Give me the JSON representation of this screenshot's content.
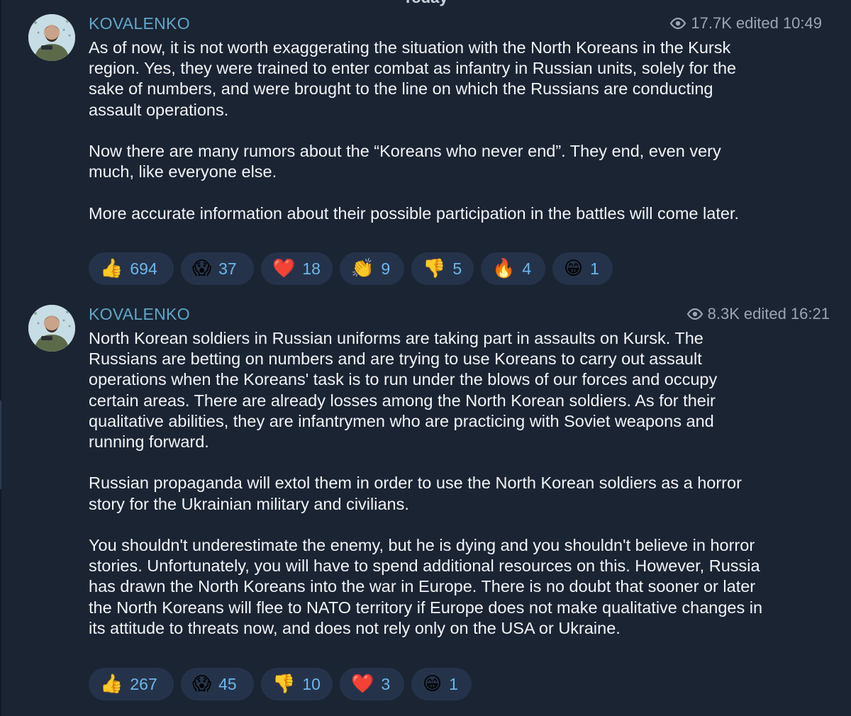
{
  "date_chip": "Today",
  "messages": [
    {
      "author": "KOVALENKO",
      "views": "17.7K",
      "edited_time": "edited 10:49",
      "paragraphs": [
        "As of now, it is not worth exaggerating the situation with the North Koreans in the Kursk region. Yes, they were trained to enter combat as infantry in Russian units, solely for the sake of numbers, and were brought to the line on which the Russians are conducting assault operations.",
        "Now there are many rumors about the “Koreans who never end”. They end, even very much, like everyone else.",
        "More accurate information about their possible participation in the battles will come later."
      ],
      "reactions": [
        {
          "emoji": "👍",
          "icon": "thumbs-up-icon",
          "count": "694"
        },
        {
          "emoji": "😱",
          "icon": "screaming-face-icon",
          "count": "37"
        },
        {
          "emoji": "❤️",
          "icon": "heart-icon",
          "count": "18"
        },
        {
          "emoji": "👏",
          "icon": "clapping-hands-icon",
          "count": "9"
        },
        {
          "emoji": "👎",
          "icon": "thumbs-down-icon",
          "count": "5"
        },
        {
          "emoji": "🔥",
          "icon": "fire-icon",
          "count": "4"
        },
        {
          "emoji": "😁",
          "icon": "grinning-face-icon",
          "count": "1"
        }
      ]
    },
    {
      "author": "KOVALENKO",
      "views": "8.3K",
      "edited_time": "edited 16:21",
      "paragraphs": [
        "North Korean soldiers in Russian uniforms are taking part in assaults on Kursk. The Russians are betting on numbers and are trying to use Koreans to carry out assault operations when the Koreans' task is to run under the blows of our forces and occupy certain areas. There are already losses among the North Korean soldiers. As for their qualitative abilities, they are infantrymen who are practicing with Soviet weapons and running forward.",
        "Russian propaganda will extol them in order to use the North Korean soldiers as a horror story for the Ukrainian military and civilians.",
        "You shouldn't underestimate the enemy, but he is dying and you shouldn't believe in horror stories. Unfortunately, you will have to spend additional resources on this. However, Russia has drawn the North Koreans into the war in Europe. There is no doubt that sooner or later the North Koreans will flee to NATO territory if Europe does not make qualitative changes in its attitude to threats now, and does not rely only on the USA or Ukraine."
      ],
      "reactions": [
        {
          "emoji": "👍",
          "icon": "thumbs-up-icon",
          "count": "267"
        },
        {
          "emoji": "😱",
          "icon": "screaming-face-icon",
          "count": "45"
        },
        {
          "emoji": "👎",
          "icon": "thumbs-down-icon",
          "count": "10"
        },
        {
          "emoji": "❤️",
          "icon": "heart-icon",
          "count": "3"
        },
        {
          "emoji": "😁",
          "icon": "grinning-face-icon",
          "count": "1"
        }
      ]
    }
  ],
  "colors": {
    "background": "#1b2433",
    "author": "#5fa7c9",
    "text": "#f2f4f7",
    "meta": "#9aa6b4",
    "reaction_bg": "#25334a",
    "reaction_count": "#6db6ee"
  }
}
